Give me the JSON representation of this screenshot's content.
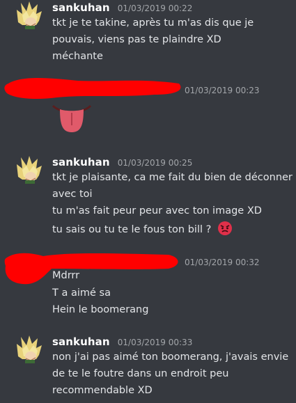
{
  "messages": [
    {
      "author": "sankuhan",
      "timestamp": "01/03/2019 00:22",
      "lines": [
        "tkt je te takine, après tu m'as dis que je",
        "pouvais, viens pas te plaindre XD",
        "méchante"
      ]
    },
    {
      "author": "",
      "timestamp": "01/03/2019 00:23",
      "lines": [],
      "emoji": "tongue-emoji"
    },
    {
      "author": "sankuhan",
      "timestamp": "01/03/2019 00:25",
      "lines": [
        "tkt je plaisante, ca me fait du bien de déconner",
        "avec toi",
        "tu m'as fait peur peur avec ton image XD",
        "tu sais ou tu te le fous ton bill ?"
      ],
      "trailing_emoji": "angry-face-emoji"
    },
    {
      "author": "",
      "timestamp": "01/03/2019 00:32",
      "lines": [
        "Mdrrr",
        "T a aimé sa",
        "Hein le boomerang"
      ]
    },
    {
      "author": "sankuhan",
      "timestamp": "01/03/2019 00:33",
      "lines": [
        "non j'ai pas aimé ton boomerang, j'avais envie",
        "de te le foutre dans un endroit peu",
        "recommendable XD"
      ]
    }
  ],
  "colors": {
    "background": "#36393f",
    "author": "#ffffff",
    "timestamp": "#a3a6aa",
    "text": "#e3e5e8",
    "redaction": "#ff0000"
  }
}
